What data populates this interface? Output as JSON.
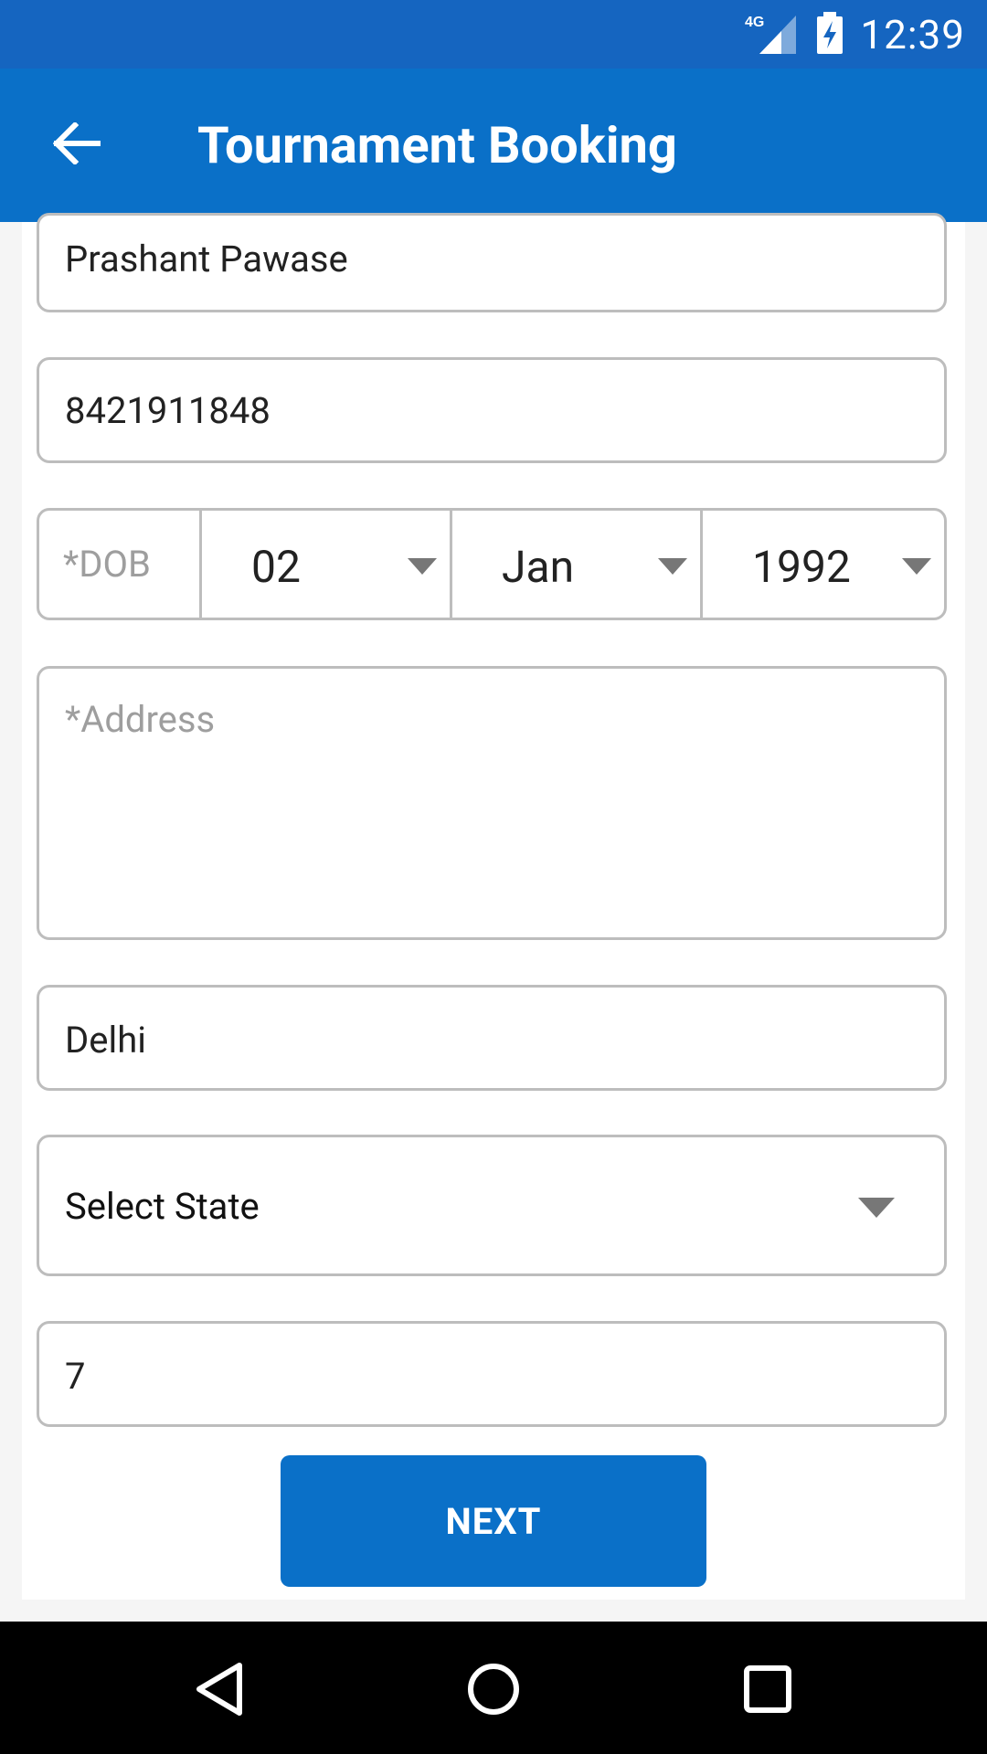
{
  "status_bar": {
    "network": "4G",
    "time": "12:39"
  },
  "app_bar": {
    "title": "Tournament Booking",
    "back_icon": "arrow-left-icon"
  },
  "form": {
    "name_value": "Prashant Pawase",
    "phone_value": "8421911848",
    "dob": {
      "label": "*DOB",
      "day": "02",
      "month": "Jan",
      "year": "1992"
    },
    "address_placeholder": "*Address",
    "city_value": "Delhi",
    "state_select": "Select State",
    "extra_value": "7",
    "next_label": "NEXT"
  },
  "nav_bar": {
    "icons": [
      "back-triangle-icon",
      "home-circle-icon",
      "recents-square-icon"
    ]
  }
}
